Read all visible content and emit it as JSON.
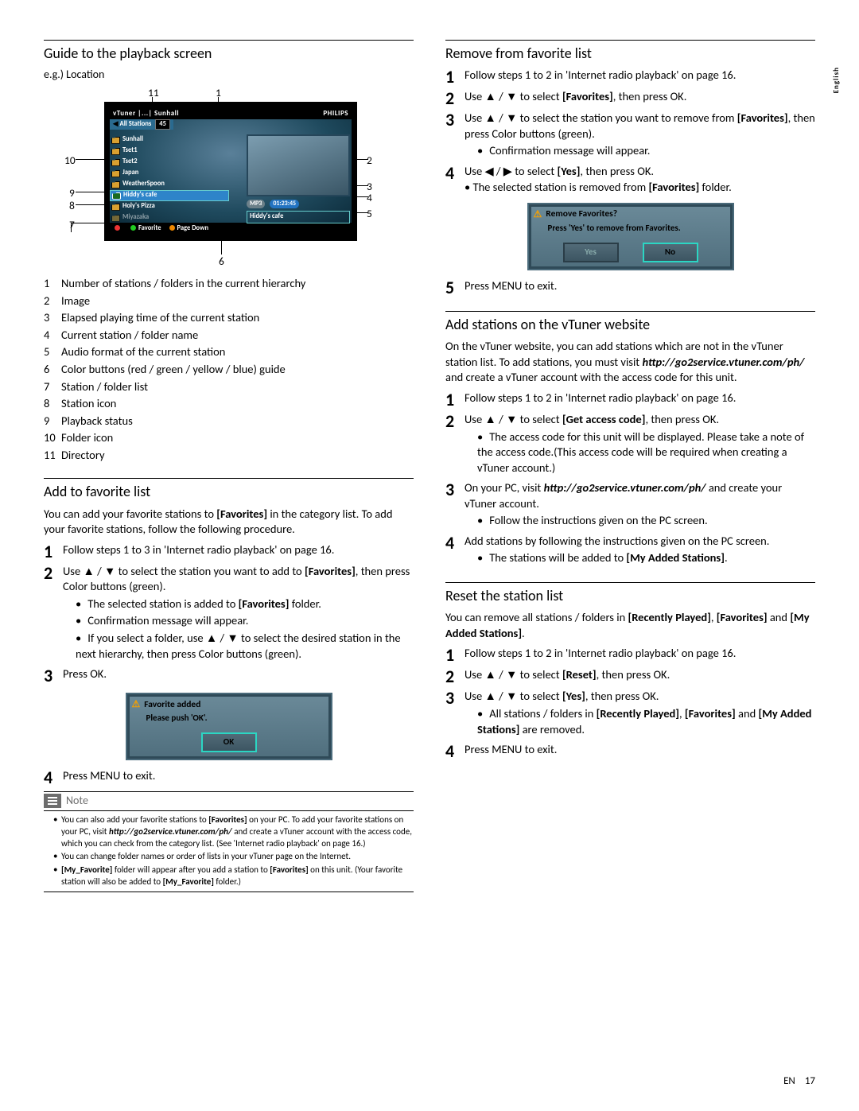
{
  "sidetab": "English",
  "footer": {
    "lang": "EN",
    "page": "17"
  },
  "left": {
    "h_guide": "Guide to the playback screen",
    "eg": "e.g.) Location",
    "diagram": {
      "crumb": "vTuner |...| Sunhall",
      "brand": "PHILIPS",
      "subbar": "All Stations",
      "count": "45",
      "stations": [
        "Sunhall",
        "Tset1",
        "Tset2",
        "Japan",
        "WeatherSpoon",
        "Hiddy's cafe",
        "Holy's Pizza",
        "Miyazaka"
      ],
      "np_format": "MP3",
      "np_time": "01:23:45",
      "np_name": "Hiddy's cafe",
      "bot_green": "Favorite",
      "bot_orange": "Page Down",
      "callouts": {
        "c1": "1",
        "c2": "2",
        "c3": "3",
        "c4": "4",
        "c5": "5",
        "c6": "6",
        "c7": "7",
        "c8": "8",
        "c9": "9",
        "c10": "10",
        "c11": "11"
      }
    },
    "legend": [
      [
        "1",
        "Number of stations / folders in the current hierarchy"
      ],
      [
        "2",
        "Image"
      ],
      [
        "3",
        "Elapsed playing time of the current station"
      ],
      [
        "4",
        "Current station / folder name"
      ],
      [
        "5",
        "Audio format of the current station"
      ],
      [
        "6",
        "Color buttons (red / green / yellow / blue) guide"
      ],
      [
        "7",
        "Station / folder list"
      ],
      [
        "8",
        "Station icon"
      ],
      [
        "9",
        "Playback status"
      ],
      [
        "10",
        "Folder icon"
      ],
      [
        "11",
        "Directory"
      ]
    ],
    "h_add": "Add to favorite list",
    "add_intro_a": "You can add your favorite stations to ",
    "add_intro_b": "[Favorites]",
    "add_intro_c": " in the category list. To add your favorite stations, follow the following procedure.",
    "add_steps": {
      "s1": "Follow steps 1 to 3 in 'Internet radio playback' on page 16.",
      "s2a": "Use ▲ / ▼ to select the station you want to add to ",
      "s2b": "[Favorites]",
      "s2c": ", then press Color buttons (green).",
      "s2_b1a": "The selected station is added to ",
      "s2_b1b": "[Favorites]",
      "s2_b1c": " folder.",
      "s2_b2": "Confirmation message will appear.",
      "s2_b3": "If you select a folder, use ▲ / ▼ to select the desired station in the next hierarchy, then press Color buttons (green).",
      "s3": "Press OK.",
      "s4": "Press MENU to exit."
    },
    "dlg_add": {
      "title": "Favorite added",
      "msg": "Please push 'OK'.",
      "ok": "OK"
    },
    "note_label": "Note",
    "notes": {
      "n1a": "You can also add your favorite stations to ",
      "n1b": "[Favorites]",
      "n1c": " on your PC. To add your favorite stations on your PC, visit ",
      "n1d": "http://go2service.vtuner.com/ph/",
      "n1e": " and create a vTuner account with the access code, which you can check from the category list. (See 'Internet radio playback' on page 16.)",
      "n2": "You can change folder names or order of lists in your vTuner page on the Internet.",
      "n3a": "[My_Favorite]",
      "n3b": " folder will appear after you add a station to ",
      "n3c": "[Favorites]",
      "n3d": " on this unit. (Your favorite station will also be added to ",
      "n3e": "[My_Favorite]",
      "n3f": " folder.)"
    }
  },
  "right": {
    "h_remove": "Remove from favorite list",
    "rm": {
      "s1": "Follow steps 1 to 2 in 'Internet radio playback' on page 16.",
      "s2a": "Use ▲ / ▼ to select ",
      "s2b": "[Favorites]",
      "s2c": ", then press OK.",
      "s3a": "Use ▲ / ▼ to select the station you want to remove from ",
      "s3b": "[Favorites]",
      "s3c": ", then press Color buttons (green).",
      "s3_b1": "Confirmation message will appear.",
      "s4a": "Use ◀ / ▶ to select ",
      "s4b": "[Yes]",
      "s4c": ", then press OK.",
      "s4_sub_a": "• The selected station is removed from ",
      "s4_sub_b": "[Favorites]",
      "s4_sub_c": " folder.",
      "s5": "Press MENU to exit."
    },
    "dlg_rm": {
      "title": "Remove Favorites?",
      "msg": "Press 'Yes' to  remove from Favorites.",
      "yes": "Yes",
      "no": "No"
    },
    "h_vtuner": "Add stations on the vTuner website",
    "vt_intro_a": "On the vTuner website, you can add stations which are not in the vTuner station list. To add stations, you must visit ",
    "vt_intro_b": "http://go2service.vtuner.com/ph/",
    "vt_intro_c": " and create a vTuner account with the access code for this unit.",
    "vt": {
      "s1": "Follow steps 1 to 2 in 'Internet radio playback' on page 16.",
      "s2a": "Use ▲ / ▼ to select ",
      "s2b": "[Get access code]",
      "s2c": ", then press OK.",
      "s2_b1": "The access code for this unit will be displayed. Please take a note of the access code.(This access code will be required when creating a vTuner account.)",
      "s3a": "On your PC, visit ",
      "s3b": "http://go2service.vtuner.com/ph/",
      "s3c": " and create your vTuner account.",
      "s3_b1": "Follow the instructions given on the PC screen.",
      "s4": "Add stations by following the instructions given on the PC screen.",
      "s4_b1a": "The stations will be added to ",
      "s4_b1b": "[My Added Stations]",
      "s4_b1c": "."
    },
    "h_reset": "Reset the station list",
    "rs_intro_a": "You can remove all stations / folders in ",
    "rs_intro_b": "[Recently Played]",
    "rs_intro_c": ", ",
    "rs_intro_d": "[Favorites]",
    "rs_intro_e": " and ",
    "rs_intro_f": "[My Added Stations]",
    "rs_intro_g": ".",
    "rs": {
      "s1": "Follow steps 1 to 2 in 'Internet radio playback' on page 16.",
      "s2a": "Use ▲ / ▼ to select ",
      "s2b": "[Reset]",
      "s2c": ", then press OK.",
      "s3a": "Use ▲ / ▼ to select ",
      "s3b": "[Yes]",
      "s3c": ", then press OK.",
      "s3_b1a": "All stations / folders in ",
      "s3_b1b": "[Recently Played]",
      "s3_b1c": ", ",
      "s3_b1d": "[Favorites]",
      "s3_b1e": "  and ",
      "s3_b1f": "[My Added Stations]",
      "s3_b1g": " are removed.",
      "s4": "Press MENU to exit."
    }
  }
}
